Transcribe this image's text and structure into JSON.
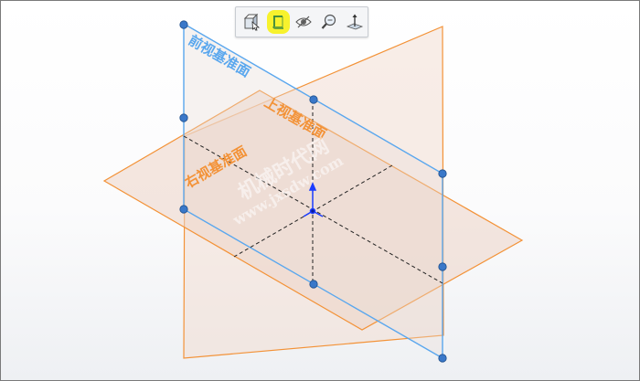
{
  "toolbar": {
    "buttons": [
      {
        "name": "view-orientation",
        "icon": "view-orientation-icon"
      },
      {
        "name": "section-view",
        "icon": "section-view-icon",
        "highlighted": true
      },
      {
        "name": "hide-show",
        "icon": "hide-show-icon"
      },
      {
        "name": "zoom",
        "icon": "zoom-icon"
      },
      {
        "name": "normal-to",
        "icon": "normal-to-icon"
      }
    ],
    "highlight_color": "#f7f22d"
  },
  "planes": {
    "front": {
      "label": "前视基准面",
      "color": "#5aa7ee"
    },
    "top": {
      "label": "上视基准面",
      "color": "#f39237"
    },
    "right": {
      "label": "右视基准面",
      "color": "#f39237"
    }
  },
  "watermark": {
    "line1": "机械时代网",
    "line2": "www.jxsdw.com"
  },
  "colors": {
    "plane_fill": "#f2dcd0",
    "axis_blue": "#1a3cff",
    "handle": "#3a78c9"
  }
}
